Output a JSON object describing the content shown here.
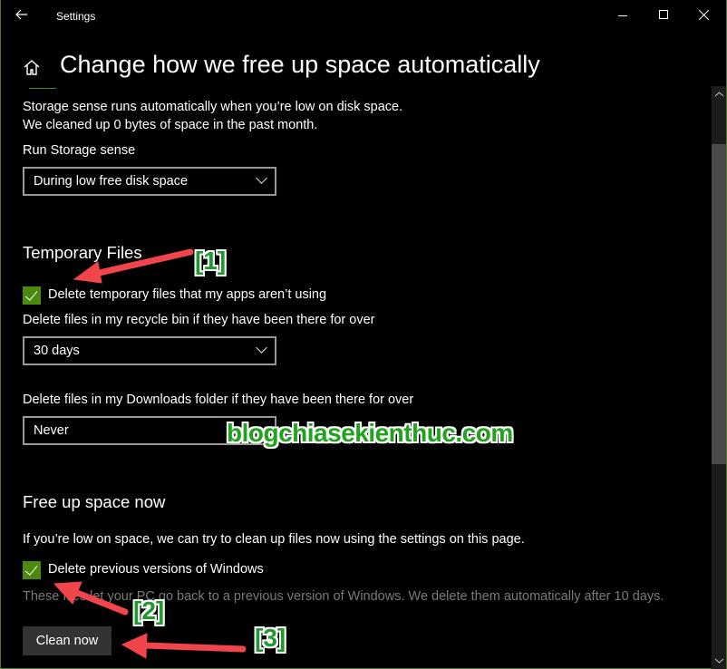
{
  "window": {
    "title": "Settings",
    "accent": "#4c8a0e"
  },
  "header": {
    "title": "Change how we free up space automatically"
  },
  "storage_sense": {
    "line1": "Storage sense runs automatically when you’re low on disk space.",
    "line2": "We cleaned up 0 bytes of space in the past month.",
    "run_label": "Run Storage sense",
    "run_value": "During low free disk space"
  },
  "temporary_files": {
    "heading": "Temporary Files",
    "delete_temp_label": "Delete temporary files that my apps aren’t using",
    "delete_temp_checked": true,
    "recycle_label": "Delete files in my recycle bin if they have been there for over",
    "recycle_value": "30 days",
    "downloads_label": "Delete files in my Downloads folder if they have been there for over",
    "downloads_value": "Never"
  },
  "free_up_now": {
    "heading": "Free up space now",
    "description": "If you’re low on space, we can try to clean up files now using the settings on this page.",
    "delete_prev_label": "Delete previous versions of Windows",
    "delete_prev_checked": true,
    "delete_prev_note": "These files let your PC go back to a previous version of Windows. We delete them automatically after 10 days.",
    "clean_button": "Clean now"
  },
  "annotations": {
    "a1": "[1]",
    "a2": "[2]",
    "a3": "[3]",
    "watermark": "blogchiasekienthuc.com"
  }
}
